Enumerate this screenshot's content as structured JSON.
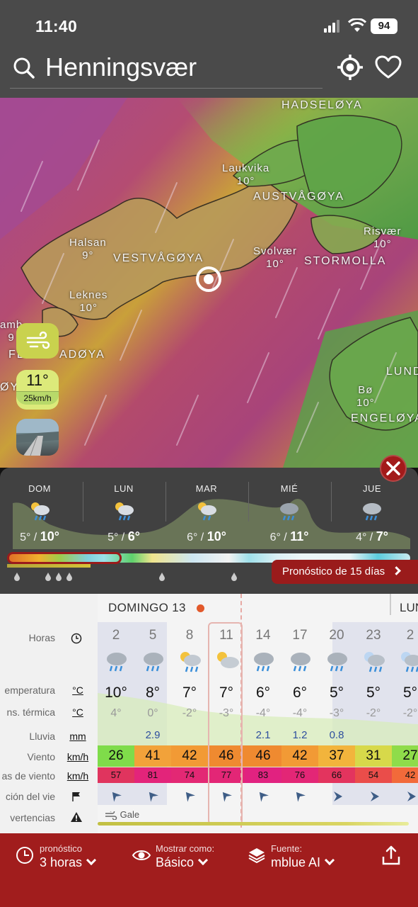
{
  "status": {
    "time": "11:40",
    "battery": "94"
  },
  "header": {
    "city": "Henningsvær"
  },
  "map": {
    "labels": [
      {
        "text": "HADSELØYA",
        "big": true
      },
      {
        "text": "Laukvika\n10°"
      },
      {
        "text": "AUSTVÅGØYA",
        "big": true
      },
      {
        "text": "Halsan\n9°"
      },
      {
        "text": "VESTVÅGØYA",
        "big": true
      },
      {
        "text": "Svolvær\n10°"
      },
      {
        "text": "STORMOLLA",
        "big": true
      },
      {
        "text": "Risvær\n10°"
      },
      {
        "text": "Leknes\n10°"
      },
      {
        "text": "amb\n9"
      },
      {
        "text": "FL"
      },
      {
        "text": "ADØYA",
        "big": true
      },
      {
        "text": "ØY",
        "big": true
      },
      {
        "text": "LUND",
        "big": true
      },
      {
        "text": "Bø\n10°"
      },
      {
        "text": "ENGELØYA",
        "big": true
      }
    ],
    "temp_button": {
      "temp": "11°",
      "wind": "25km/h"
    }
  },
  "daily": {
    "days": [
      {
        "name": "DOM",
        "low": "5°",
        "high": "10°",
        "icon": "rain-sun-icon"
      },
      {
        "name": "LUN",
        "low": "5°",
        "high": "6°",
        "icon": "rain-sun-icon"
      },
      {
        "name": "MAR",
        "low": "6°",
        "high": "10°",
        "icon": "rain-sun-icon"
      },
      {
        "name": "MIÉ",
        "low": "6°",
        "high": "11°",
        "icon": "rain-cloud-icon"
      },
      {
        "name": "JUE",
        "low": "4°",
        "high": "7°",
        "icon": "rain-cloud-icon"
      }
    ],
    "forecast_button": "Pronóstico de 15 días"
  },
  "hourly": {
    "day_header": "DOMINGO 13",
    "next_day_header": "LUN",
    "row_labels": {
      "hours": "Horas",
      "temp": "emperatura",
      "feel": "ns. térmica",
      "rain": "Lluvia",
      "wind": "Viento",
      "gusts": "as de viento",
      "dir": "ción del vie",
      "warnings": "vertencias"
    },
    "units": {
      "temp": "°C",
      "feel": "°C",
      "rain": "mm",
      "wind": "km/h",
      "gusts": "km/h"
    },
    "columns": [
      {
        "hour": "2",
        "temp": "10°",
        "feel": "4°",
        "rain": "",
        "wind": "26",
        "gust": "57",
        "wind_color": "#7fdc4a",
        "gust_color": "#e0345e",
        "icon": "rain-cloud-icon"
      },
      {
        "hour": "5",
        "temp": "8°",
        "feel": "0°",
        "rain": "2.9",
        "wind": "41",
        "gust": "81",
        "wind_color": "#f2a23a",
        "gust_color": "#e3247a",
        "icon": "rain-cloud-icon"
      },
      {
        "hour": "8",
        "temp": "7°",
        "feel": "-2°",
        "rain": "",
        "wind": "42",
        "gust": "74",
        "wind_color": "#f29a35",
        "gust_color": "#e32874",
        "icon": "rain-sun-icon"
      },
      {
        "hour": "11",
        "temp": "7°",
        "feel": "-3°",
        "rain": "",
        "wind": "46",
        "gust": "77",
        "wind_color": "#ef8a30",
        "gust_color": "#e32676",
        "icon": "sun-cloud-icon"
      },
      {
        "hour": "14",
        "temp": "6°",
        "feel": "-4°",
        "rain": "2.1",
        "wind": "46",
        "gust": "83",
        "wind_color": "#ef8a30",
        "gust_color": "#e12280",
        "icon": "rain-cloud-icon"
      },
      {
        "hour": "17",
        "temp": "6°",
        "feel": "-4°",
        "rain": "1.2",
        "wind": "42",
        "gust": "76",
        "wind_color": "#f29a35",
        "gust_color": "#e32676",
        "icon": "rain-cloud-icon"
      },
      {
        "hour": "20",
        "temp": "5°",
        "feel": "-3°",
        "rain": "0.8",
        "wind": "37",
        "gust": "66",
        "wind_color": "#f2b43c",
        "gust_color": "#e3345e",
        "icon": "rain-cloud-icon"
      },
      {
        "hour": "23",
        "temp": "5°",
        "feel": "-2°",
        "rain": "",
        "wind": "31",
        "gust": "54",
        "wind_color": "#d7d94a",
        "gust_color": "#ea4d4a",
        "icon": "rain-moon-icon"
      },
      {
        "hour": "2",
        "temp": "5°",
        "feel": "-2°",
        "rain": "",
        "wind": "27",
        "gust": "42",
        "wind_color": "#8fdc4a",
        "gust_color": "#f26a3a",
        "icon": "rain-moon-icon"
      }
    ],
    "warning": "Gale"
  },
  "bottom": {
    "forecast": {
      "small": "pronóstico",
      "big": "3 horas"
    },
    "display": {
      "small": "Mostrar como:",
      "big": "Básico"
    },
    "source": {
      "small": "Fuente:",
      "big": "mblue AI"
    }
  }
}
